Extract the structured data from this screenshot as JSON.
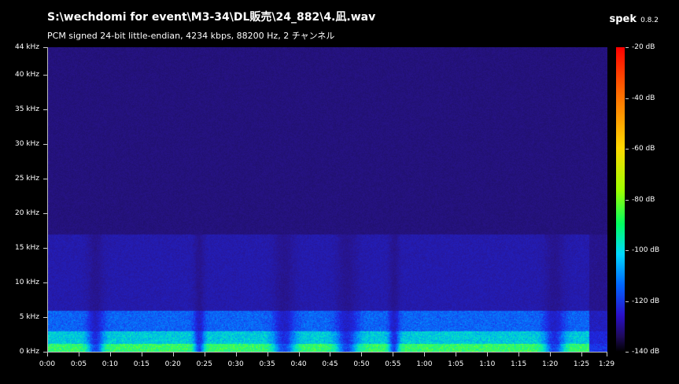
{
  "header": {
    "title": "S:\\wechdomi for event\\M3-34\\DL販売\\24_882\\4.凪.wav",
    "subtitle": "PCM signed 24-bit little-endian, 4234 kbps, 88200 Hz, 2 チャンネル",
    "app_name": "spek",
    "app_version": "0.8.2"
  },
  "y_axis": {
    "labels": [
      "44 kHz",
      "40 kHz",
      "35 kHz",
      "30 kHz",
      "25 kHz",
      "20 kHz",
      "15 kHz",
      "10 kHz",
      "5 kHz",
      "0 kHz"
    ],
    "values_khz": [
      44,
      40,
      35,
      30,
      25,
      20,
      15,
      10,
      5,
      0
    ]
  },
  "x_axis": {
    "labels": [
      "0:00",
      "0:05",
      "0:10",
      "0:15",
      "0:20",
      "0:25",
      "0:30",
      "0:35",
      "0:40",
      "0:45",
      "0:50",
      "0:55",
      "1:00",
      "1:05",
      "1:10",
      "1:15",
      "1:20",
      "1:25",
      "1:29"
    ],
    "values_sec": [
      0,
      5,
      10,
      15,
      20,
      25,
      30,
      35,
      40,
      45,
      50,
      55,
      60,
      65,
      70,
      75,
      80,
      85,
      89
    ]
  },
  "color_scale": {
    "labels": [
      "-20 dB",
      "-40 dB",
      "-60 dB",
      "-80 dB",
      "-100 dB",
      "-120 dB",
      "-140 dB"
    ],
    "values_db": [
      -20,
      -40,
      -60,
      -80,
      -100,
      -120,
      -140
    ]
  },
  "colors": {
    "background": "#000000",
    "plot_floor": "#1a0d4a"
  }
}
